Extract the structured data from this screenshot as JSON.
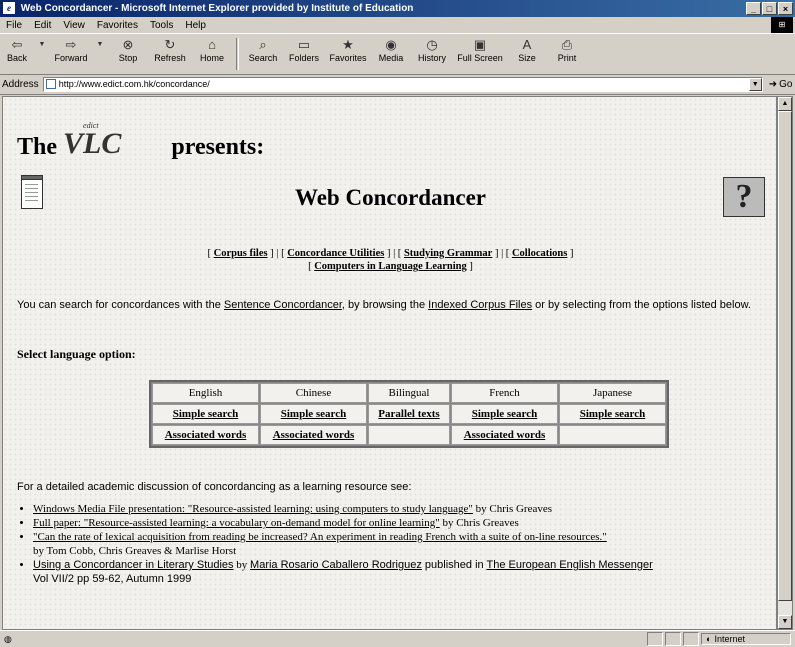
{
  "window": {
    "title": "Web Concordancer - Microsoft Internet Explorer provided by Institute of Education",
    "controls": [
      "_",
      "□",
      "×"
    ]
  },
  "menu": [
    "File",
    "Edit",
    "View",
    "Favorites",
    "Tools",
    "Help"
  ],
  "toolbar": {
    "back": "Back",
    "forward": "Forward",
    "stop": "Stop",
    "refresh": "Refresh",
    "home": "Home",
    "search": "Search",
    "folders": "Folders",
    "favorites": "Favorites",
    "media": "Media",
    "history": "History",
    "fullscreen": "Full Screen",
    "size": "Size",
    "print": "Print"
  },
  "address": {
    "label": "Address",
    "url": "http://www.edict.com.hk/concordance/",
    "go": "Go"
  },
  "page": {
    "the": "The",
    "logo": "VLC",
    "logo_small": "edict",
    "presents": "presents:",
    "title": "Web Concordancer",
    "help_glyph": "?",
    "nav": {
      "corpus": "Corpus files",
      "utilities": "Concordance Utilities",
      "grammar": "Studying Grammar",
      "collocations": "Collocations",
      "computers": "Computers in Language Learning"
    },
    "intro": {
      "part1": "You can search for concordances with the ",
      "link1": "Sentence Concordancer",
      "part2": ", by browsing the ",
      "link2": "Indexed Corpus Files",
      "part3": " or by selecting from the options listed below."
    },
    "select_label": "Select language option:",
    "languages": {
      "headers": [
        "English",
        "Chinese",
        "Bilingual",
        "French",
        "Japanese"
      ],
      "row1": [
        "Simple search",
        "Simple search",
        "Parallel texts",
        "Simple search",
        "Simple search"
      ],
      "row2": [
        "Associated words",
        "Associated words",
        "",
        "Associated words",
        ""
      ]
    },
    "discussion": "For a detailed academic discussion of concordancing as a learning resource see:",
    "refs": {
      "r1_link": "Windows Media File presentation: \"Resource-assisted learning: using computers to study language\"",
      "r1_text": " by Chris Greaves",
      "r2_link": "Full paper: \"Resource-assisted learning: a vocabulary on-demand model for online learning\"",
      "r2_text": " by Chris Greaves",
      "r3_link": "\"Can the rate of lexical acquisition from reading be increased? An experiment in reading French with a suite of on-line resources.\"",
      "r3_text": "by Tom Cobb, Chris Greaves & Marlise Horst",
      "r4_link": "Using a Concordancer in Literary Studies",
      "r4_by": " by ",
      "r4_author": "Maria Rosario Caballero Rodriguez",
      "r4_pub": " published in ",
      "r4_journal": "The European English Messenger",
      "r4_tail": "Vol VII/2 pp 59-62, Autumn 1999"
    }
  },
  "status": {
    "zone": "Internet"
  }
}
